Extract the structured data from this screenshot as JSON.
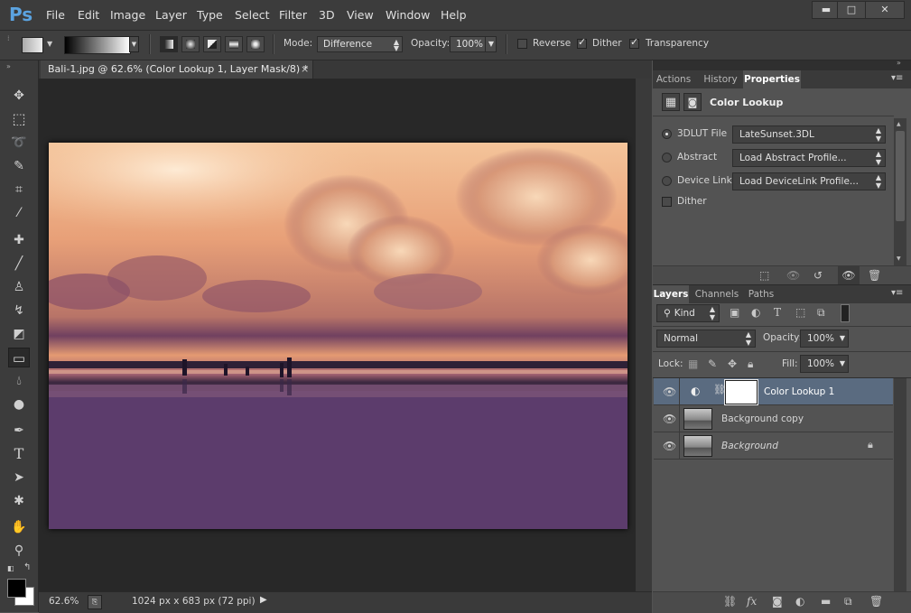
{
  "app": {
    "logo": "Ps"
  },
  "menu": [
    "File",
    "Edit",
    "Image",
    "Layer",
    "Type",
    "Select",
    "Filter",
    "3D",
    "View",
    "Window",
    "Help"
  ],
  "window_controls": {
    "minimize": "▬",
    "maximize": "□",
    "close": "✕"
  },
  "options": {
    "mode_label": "Mode:",
    "mode_value": "Difference",
    "opacity_label": "Opacity:",
    "opacity_value": "100%",
    "reverse_label": "Reverse",
    "reverse_checked": false,
    "dither_label": "Dither",
    "dither_checked": true,
    "transparency_label": "Transparency",
    "transparency_checked": true
  },
  "document": {
    "tab_title": "Bali-1.jpg @ 62.6% (Color Lookup 1, Layer Mask/8) *",
    "tab_close": "×"
  },
  "status": {
    "zoom": "62.6%",
    "info": "1024 px x 683 px (72 ppi)"
  },
  "properties_panel": {
    "tabs": [
      "Actions",
      "History",
      "Properties"
    ],
    "active_tab": "Properties",
    "title": "Color Lookup",
    "rows": [
      {
        "label": "3DLUT File",
        "value": "LateSunset.3DL",
        "selected": true
      },
      {
        "label": "Abstract",
        "value": "Load Abstract Profile...",
        "selected": false
      },
      {
        "label": "Device Link",
        "value": "Load DeviceLink Profile...",
        "selected": false
      }
    ],
    "dither_label": "Dither"
  },
  "layers_panel": {
    "tabs": [
      "Layers",
      "Channels",
      "Paths"
    ],
    "active_tab": "Layers",
    "filter_label": "Kind",
    "blend_mode": "Normal",
    "opacity_label": "Opacity:",
    "opacity_value": "100%",
    "lock_label": "Lock:",
    "fill_label": "Fill:",
    "fill_value": "100%",
    "layers": [
      {
        "name": "Color Lookup 1",
        "selected": true,
        "type": "adjustment"
      },
      {
        "name": "Background copy",
        "selected": false,
        "type": "image"
      },
      {
        "name": "Background",
        "selected": false,
        "type": "image",
        "locked": true
      }
    ]
  },
  "colors": {
    "accent_ps": "#5ba3e0",
    "selected_layer": "#5a6b80",
    "canvas_bg": "#282828"
  }
}
